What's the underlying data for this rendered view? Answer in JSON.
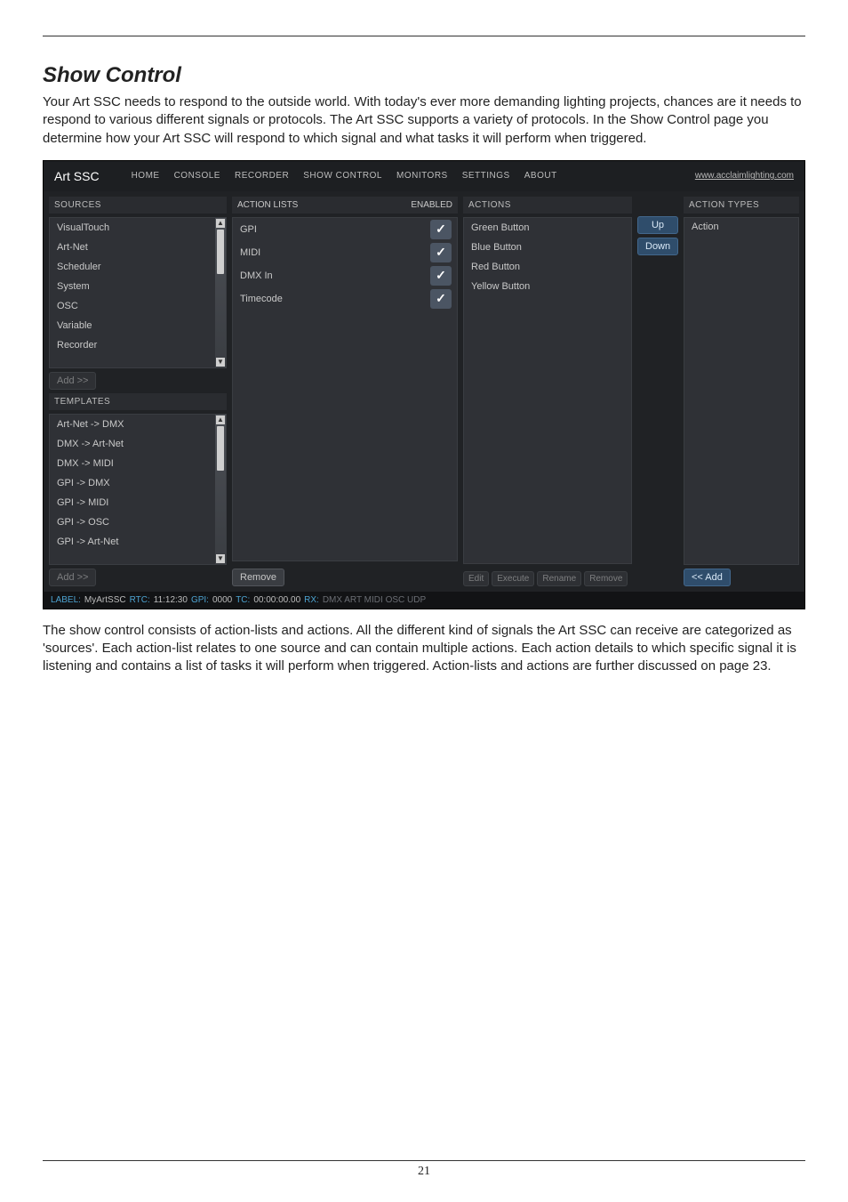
{
  "section": {
    "title": "Show Control",
    "intro": "Your Art SSC needs to respond to the outside world. With today's ever more demanding lighting projects, chances are it needs to respond to various different signals or protocols. The Art SSC supports a variety of protocols. In the Show Control page you determine how your Art SSC will respond to which signal and what tasks it will perform when triggered.",
    "outro": "The show control consists of action-lists and actions. All the different kind of signals the Art SSC can receive are categorized as 'sources'. Each action-list relates to one source and can contain multiple actions. Each action details to which specific signal it is listening and contains a list of tasks it will perform when triggered. Action-lists and actions are further discussed on page 23."
  },
  "app": {
    "brand": "Art SSC",
    "site_link": "www.acclaimlighting.com",
    "menu": {
      "home": "HOME",
      "console": "CONSOLE",
      "recorder": "RECORDER",
      "show_control": "SHOW CONTROL",
      "monitors": "MONITORS",
      "settings": "SETTINGS",
      "about": "ABOUT"
    },
    "sources": {
      "header": "SOURCES",
      "items": [
        "VisualTouch",
        "Art-Net",
        "Scheduler",
        "System",
        "OSC",
        "Variable",
        "Recorder"
      ],
      "add_label": "Add >>"
    },
    "templates": {
      "header": "TEMPLATES",
      "items": [
        "Art-Net -> DMX",
        "DMX -> Art-Net",
        "DMX -> MIDI",
        "GPI -> DMX",
        "GPI -> MIDI",
        "GPI -> OSC",
        "GPI -> Art-Net"
      ],
      "add_label": "Add >>"
    },
    "action_lists": {
      "header_name": "ACTION LISTS",
      "header_enabled": "ENABLED",
      "rows": [
        {
          "name": "GPI",
          "enabled": true
        },
        {
          "name": "MIDI",
          "enabled": true
        },
        {
          "name": "DMX In",
          "enabled": true
        },
        {
          "name": "Timecode",
          "enabled": true
        }
      ],
      "remove_label": "Remove"
    },
    "actions_panel": {
      "header": "ACTIONS",
      "items": [
        "Green Button",
        "Blue Button",
        "Red Button",
        "Yellow Button"
      ],
      "buttons": {
        "edit": "Edit",
        "execute": "Execute",
        "rename": "Rename",
        "remove": "Remove"
      }
    },
    "updown": {
      "up": "Up",
      "down": "Down"
    },
    "action_types": {
      "header": "ACTION TYPES",
      "item": "Action",
      "add_label": "<< Add"
    },
    "statusbar": {
      "label_k": "LABEL:",
      "label_v": "MyArtSSC",
      "rtc_k": "RTC:",
      "rtc_v": "11:12:30",
      "gpi_k": "GPI:",
      "gpi_v": "0000",
      "tc_k": "TC:",
      "tc_v": "00:00:00.00",
      "rx_k": "RX:",
      "rx_v": "DMX ART MIDI OSC UDP"
    }
  },
  "page_number": "21"
}
